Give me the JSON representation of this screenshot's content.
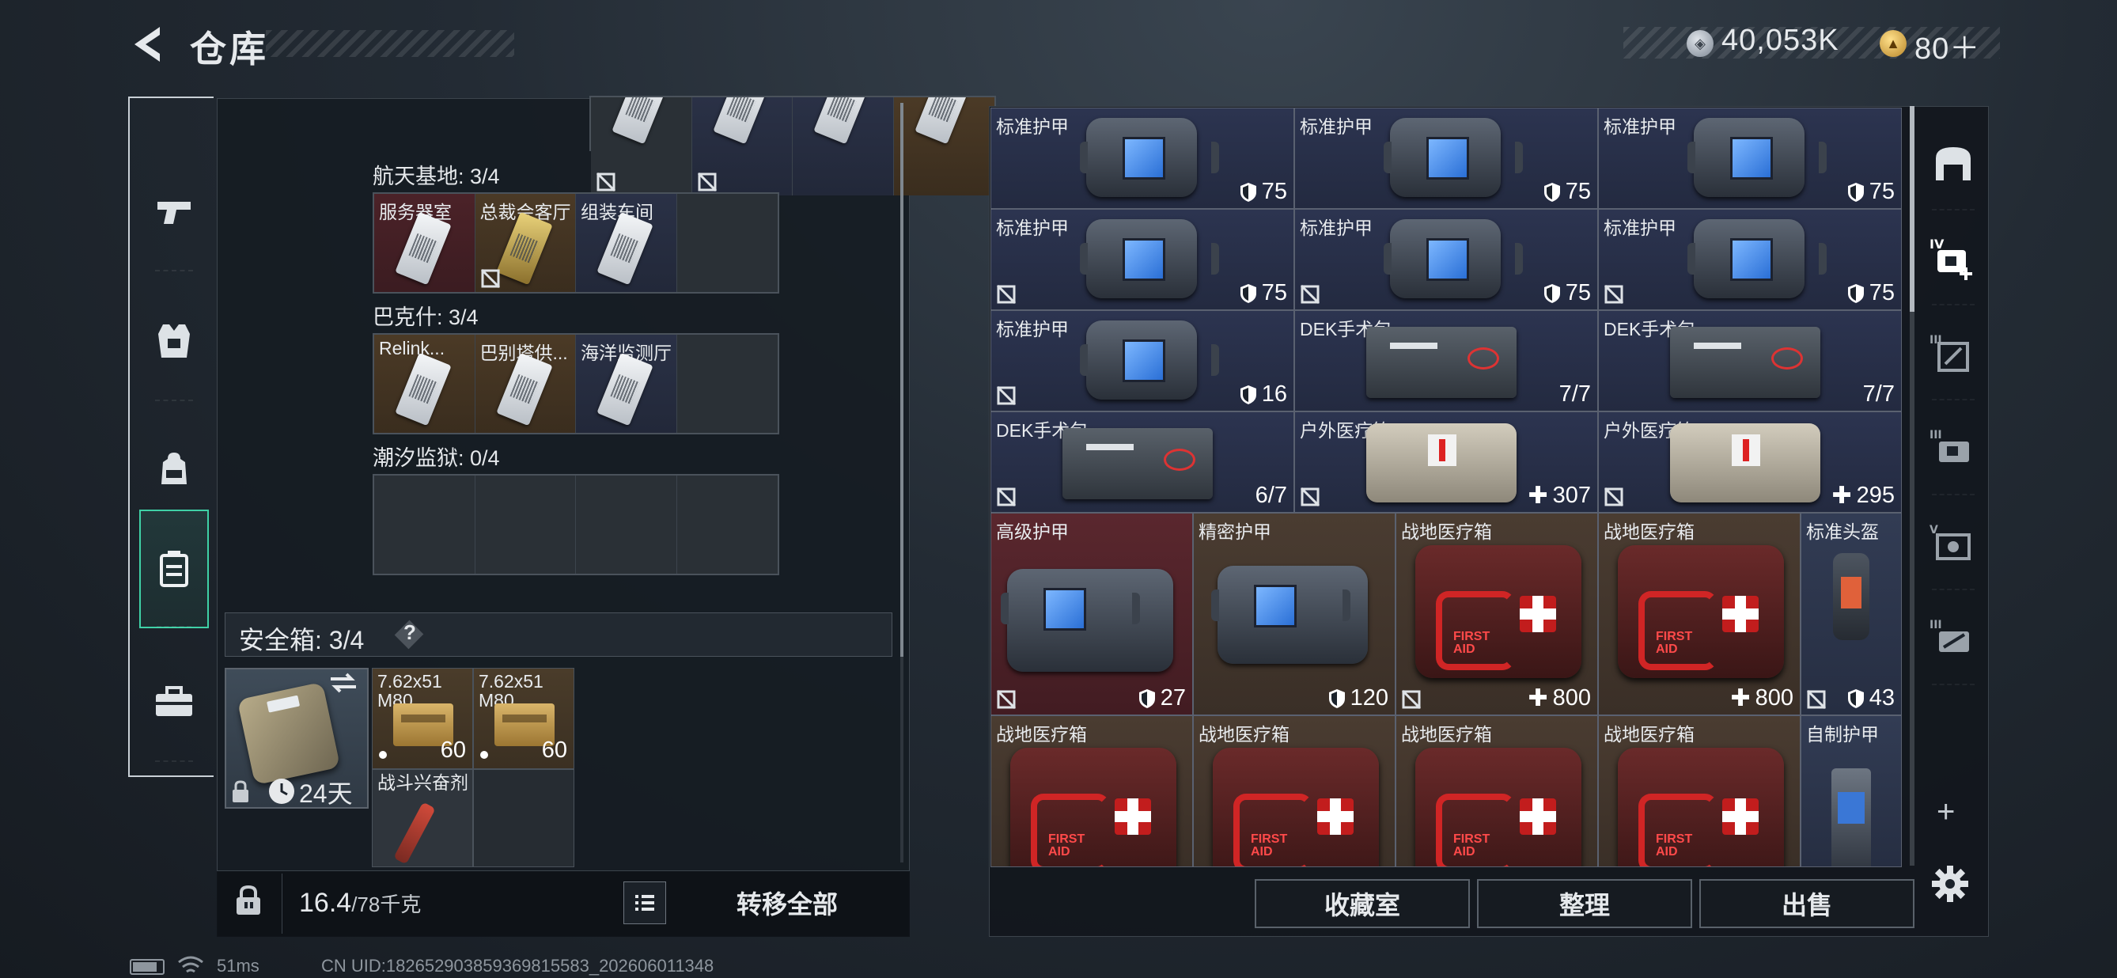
{
  "header": {
    "title": "仓库"
  },
  "currency": {
    "coins": "40,053K",
    "premium": "80＋"
  },
  "collections": [
    {
      "title": "航天基地: 3/4",
      "cards": [
        "服务器室",
        "总裁会客厅",
        "组装车间",
        ""
      ]
    },
    {
      "title": "巴克什: 3/4",
      "cards": [
        "Relink...",
        "巴别塔供...",
        "海洋监测厅",
        ""
      ]
    },
    {
      "title": "潮汐监狱: 0/4",
      "cards": [
        "",
        "",
        "",
        ""
      ]
    }
  ],
  "safe": {
    "label": "安全箱: 3/4",
    "help": "?",
    "days": "24天",
    "items": [
      {
        "name": "7.62x51 M80",
        "count": "60"
      },
      {
        "name": "7.62x51 M80",
        "count": "60"
      },
      {
        "name": "战斗兴奋剂",
        "count": ""
      }
    ]
  },
  "weight": {
    "current": "16.4",
    "max": "/78千克"
  },
  "actions": {
    "transfer_all": "转移全部",
    "collection_room": "收藏室",
    "organize": "整理",
    "sell": "出售"
  },
  "stash": [
    {
      "name": "标准护甲",
      "value": "75"
    },
    {
      "name": "标准护甲",
      "value": "75"
    },
    {
      "name": "标准护甲",
      "value": "75"
    },
    {
      "name": "标准护甲",
      "value": "75"
    },
    {
      "name": "标准护甲",
      "value": "75"
    },
    {
      "name": "标准护甲",
      "value": "75"
    },
    {
      "name": "标准护甲",
      "value": "16"
    },
    {
      "name": "DEK手术包",
      "value": "7/7"
    },
    {
      "name": "DEK手术包",
      "value": "7/7"
    },
    {
      "name": "DEK手术包",
      "value": "6/7"
    },
    {
      "name": "户外医疗箱",
      "value": "307"
    },
    {
      "name": "户外医疗箱",
      "value": "295"
    },
    {
      "name": "高级护甲",
      "value": "27"
    },
    {
      "name": "精密护甲",
      "value": "120"
    },
    {
      "name": "战地医疗箱",
      "value": "800"
    },
    {
      "name": "战地医疗箱",
      "value": "800"
    },
    {
      "name": "标准头盔",
      "value": "43"
    },
    {
      "name": "战地医疗箱",
      "value": ""
    },
    {
      "name": "战地医疗箱",
      "value": ""
    },
    {
      "name": "战地医疗箱",
      "value": ""
    },
    {
      "name": "战地医疗箱",
      "value": ""
    },
    {
      "name": "自制护甲",
      "value": ""
    }
  ],
  "firstaid_text": "FIRST\nAID",
  "status": {
    "ping": "51ms",
    "uid": "CN UID:182652903859369815583_202606011348"
  },
  "colors": {
    "accent": "#3fd1a6",
    "red_cell": "#5a272e",
    "navy_cell": "#2c3450",
    "brown_cell": "#4a3c31"
  }
}
